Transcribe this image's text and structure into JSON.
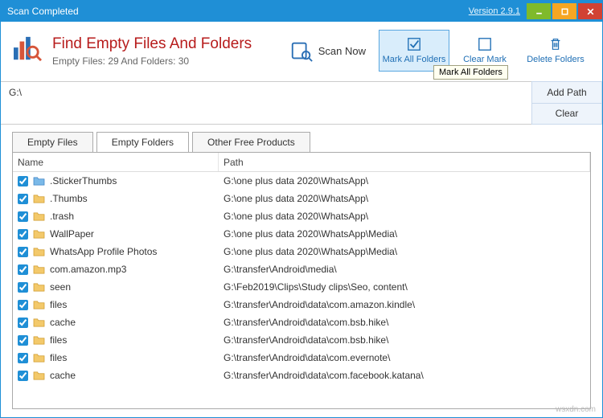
{
  "titlebar": {
    "status": "Scan Completed",
    "version": "Version 2.9.1"
  },
  "app": {
    "title": "Find Empty Files And Folders",
    "stats": "Empty Files: 29 And Folders: 30"
  },
  "toolbar": {
    "scan_now": "Scan Now",
    "mark_all": "Mark All Folders",
    "clear_mark": "Clear Mark",
    "delete_folders": "Delete Folders",
    "tooltip": "Mark All Folders"
  },
  "paths": {
    "current": "G:\\",
    "add": "Add Path",
    "clear": "Clear"
  },
  "tabs": {
    "files": "Empty Files",
    "folders": "Empty Folders",
    "other": "Other Free Products"
  },
  "columns": {
    "name": "Name",
    "path": "Path"
  },
  "rows": [
    {
      "name": ".StickerThumbs",
      "path": "G:\\one plus data 2020\\WhatsApp\\",
      "blue": true
    },
    {
      "name": ".Thumbs",
      "path": "G:\\one plus data 2020\\WhatsApp\\",
      "blue": false
    },
    {
      "name": ".trash",
      "path": "G:\\one plus data 2020\\WhatsApp\\",
      "blue": false
    },
    {
      "name": "WallPaper",
      "path": "G:\\one plus data 2020\\WhatsApp\\Media\\",
      "blue": false
    },
    {
      "name": "WhatsApp Profile Photos",
      "path": "G:\\one plus data 2020\\WhatsApp\\Media\\",
      "blue": false
    },
    {
      "name": "com.amazon.mp3",
      "path": "G:\\transfer\\Android\\media\\",
      "blue": false
    },
    {
      "name": "seen",
      "path": "G:\\Feb2019\\Clips\\Study clips\\Seo, content\\",
      "blue": false
    },
    {
      "name": "files",
      "path": "G:\\transfer\\Android\\data\\com.amazon.kindle\\",
      "blue": false
    },
    {
      "name": "cache",
      "path": "G:\\transfer\\Android\\data\\com.bsb.hike\\",
      "blue": false
    },
    {
      "name": "files",
      "path": "G:\\transfer\\Android\\data\\com.bsb.hike\\",
      "blue": false
    },
    {
      "name": "files",
      "path": "G:\\transfer\\Android\\data\\com.evernote\\",
      "blue": false
    },
    {
      "name": "cache",
      "path": "G:\\transfer\\Android\\data\\com.facebook.katana\\",
      "blue": false
    }
  ],
  "watermark": "wsxdn.com"
}
